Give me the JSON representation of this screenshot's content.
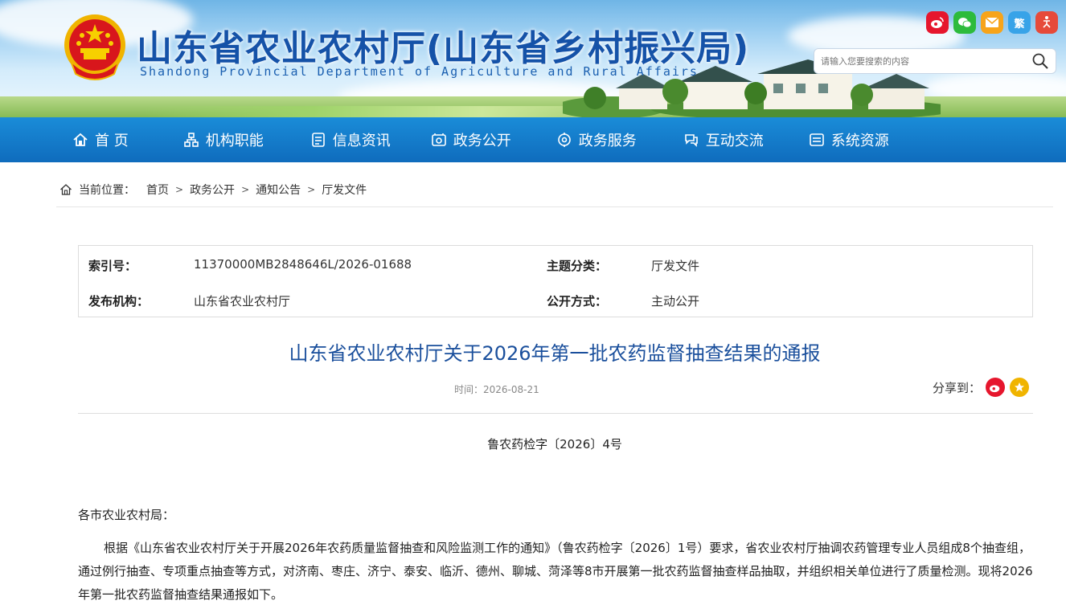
{
  "header": {
    "title": "山东省农业农村厅(山东省乡村振兴局)",
    "subtitle": "Shandong Provincial Department of Agriculture and Rural Affairs",
    "search_placeholder": "请输入您要搜索的内容",
    "social": [
      {
        "name": "weibo-icon",
        "label": "微",
        "color": "#e6162d"
      },
      {
        "name": "wechat-icon",
        "label": "信",
        "color": "#2dbb3c"
      },
      {
        "name": "mail-icon",
        "label": "✉",
        "color": "#f7a41a"
      },
      {
        "name": "traditional-chinese-icon",
        "label": "繁",
        "color": "#38a3e8"
      },
      {
        "name": "accessibility-icon",
        "label": "♿",
        "color": "#e64a3a"
      }
    ]
  },
  "nav": [
    {
      "label": "首 页",
      "icon": "home-icon"
    },
    {
      "label": "机构职能",
      "icon": "org-icon"
    },
    {
      "label": "信息资讯",
      "icon": "info-icon"
    },
    {
      "label": "政务公开",
      "icon": "gov-open-icon"
    },
    {
      "label": "政务服务",
      "icon": "service-icon"
    },
    {
      "label": "互动交流",
      "icon": "chat-icon"
    },
    {
      "label": "系统资源",
      "icon": "resource-icon"
    }
  ],
  "breadcrumb": {
    "label": "当前位置：",
    "items": [
      "首页",
      "政务公开",
      "通知公告",
      "厅发文件"
    ],
    "separator": ">"
  },
  "meta": {
    "index_key": "索引号：",
    "index_val": "11370000MB2848646L/2026-01688",
    "category_key": "主题分类：",
    "category_val": "厅发文件",
    "issuer_key": "发布机构：",
    "issuer_val": "山东省农业农村厅",
    "disclosure_key": "公开方式：",
    "disclosure_val": "主动公开"
  },
  "article": {
    "title": "山东省农业农村厅关于2026年第一批农药监督抽查结果的通报",
    "date_label": "时间：",
    "date": "2026-08-21",
    "share_label": "分享到：",
    "doc_number": "鲁农药检字〔2026〕4号",
    "salutation": "各市农业农村局：",
    "paragraph": "根据《山东省农业农村厅关于开展2026年农药质量监督抽查和风险监测工作的通知》（鲁农药检字〔2026〕1号）要求，省农业农村厅抽调农药管理专业人员组成8个抽查组，通过例行抽查、专项重点抽查等方式，对济南、枣庄、济宁、泰安、临沂、德州、聊城、菏泽等8市开展第一批农药监督抽查样品抽取，并组织相关单位进行了质量检测。现将2026年第一批农药监督抽查结果通报如下。"
  },
  "colors": {
    "nav_bg": "#0f6cbd",
    "title_blue": "#1552a8",
    "article_title": "#1a4f9c"
  }
}
